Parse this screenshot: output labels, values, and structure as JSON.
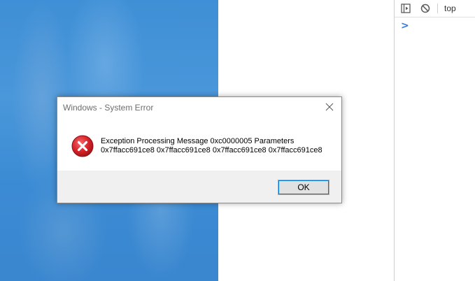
{
  "console": {
    "context_label": "top",
    "prompt_symbol": ">",
    "icons": [
      "sidebar-toggle-icon",
      "clear-console-icon"
    ]
  },
  "dialog": {
    "title": "Windows - System Error",
    "message_line1": "Exception Processing Message 0xc0000005 Parameters",
    "message_line2": "0x7ffacc691ce8 0x7ffacc691ce8 0x7ffacc691ce8 0x7ffacc691ce8",
    "ok_label": "OK",
    "icon": "error-icon",
    "error_color": "#d9232a"
  },
  "colors": {
    "wallpaper": "#3f8fd6",
    "prompt": "#2f7ae5",
    "footer": "#f0f0f0",
    "button_focus": "#0078d7"
  }
}
